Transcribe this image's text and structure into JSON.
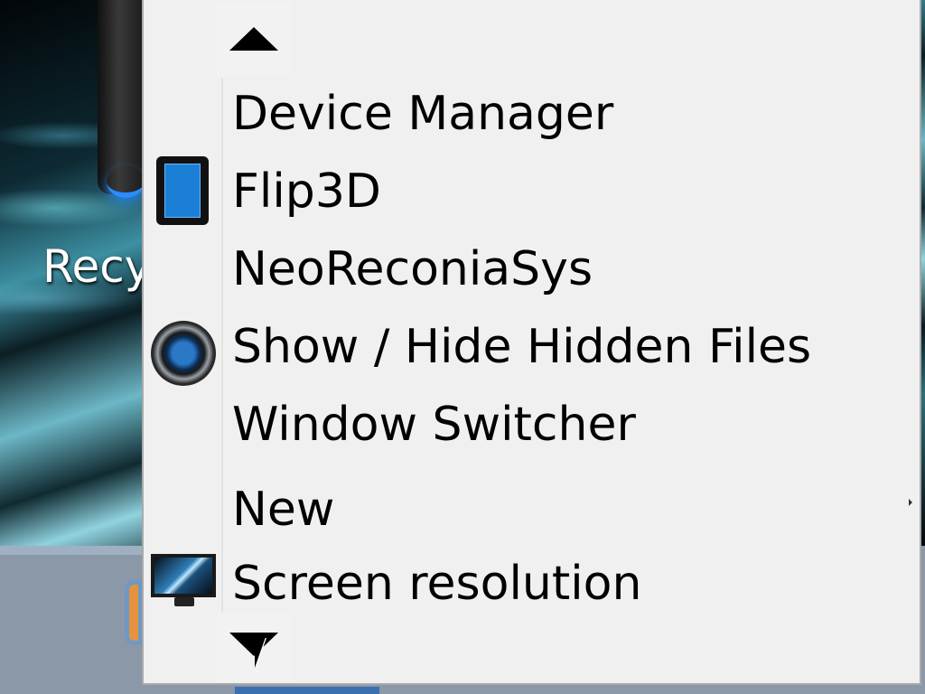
{
  "desktop": {
    "partial_label": "Recy"
  },
  "context_menu": {
    "scroll_up": {
      "icon": "triangle-up-icon"
    },
    "scroll_down": {
      "icon": "triangle-down-icon"
    },
    "items": [
      {
        "label": "Device Manager",
        "icon": null,
        "has_submenu": false
      },
      {
        "label": "Flip3D",
        "icon": "tablet-icon",
        "has_submenu": false
      },
      {
        "label": "NeoReconiaSys",
        "icon": null,
        "has_submenu": false
      },
      {
        "label": "Show / Hide Hidden Files",
        "icon": "speaker-icon",
        "has_submenu": false
      },
      {
        "label": "Window Switcher",
        "icon": null,
        "has_submenu": false
      },
      {
        "label": "New",
        "icon": null,
        "has_submenu": true
      },
      {
        "label": "Screen resolution",
        "icon": "monitor-icon",
        "has_submenu": false
      }
    ]
  },
  "colors": {
    "menu_background": "#f0f0f0",
    "menu_border": "#a9a9a9",
    "text": "#000000",
    "icon_accent": "#1c7fd6"
  }
}
